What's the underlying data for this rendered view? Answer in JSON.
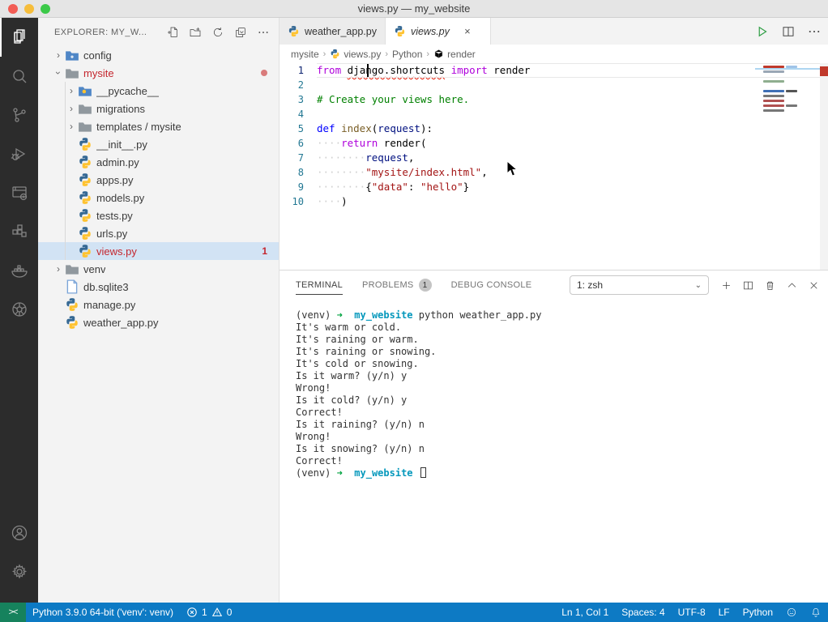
{
  "window": {
    "title": "views.py — my_website"
  },
  "colors": {
    "status_bar": "#0d7ac4",
    "remote_indicator": "#16825d",
    "activity_bar": "#2c2c2c",
    "sidebar": "#f3f3f3",
    "selection_row": "#d2e3f4",
    "error_red": "#c4262e",
    "traffic_red": "#f25c54",
    "traffic_yellow": "#f6bd3b",
    "traffic_green": "#3bc948",
    "run_green": "#2e9e44"
  },
  "activity_bar": {
    "items": [
      {
        "name": "explorer",
        "active": true
      },
      {
        "name": "search",
        "active": false
      },
      {
        "name": "source-control",
        "active": false
      },
      {
        "name": "run-debug",
        "active": false
      },
      {
        "name": "remote-explorer",
        "active": false
      },
      {
        "name": "extensions",
        "active": false
      },
      {
        "name": "docker",
        "active": false
      },
      {
        "name": "kubernetes",
        "active": false
      }
    ],
    "bottom_items": [
      {
        "name": "account",
        "active": false
      },
      {
        "name": "settings",
        "active": false
      }
    ]
  },
  "explorer": {
    "header": "EXPLORER: MY_W...",
    "actions": [
      "new-file",
      "new-folder",
      "refresh",
      "collapse-all",
      "more"
    ],
    "tree": [
      {
        "label": "config",
        "type": "folder",
        "depth": 0,
        "expanded": false,
        "icon": "folder-config"
      },
      {
        "label": "mysite",
        "type": "folder",
        "depth": 0,
        "expanded": true,
        "icon": "folder-gray",
        "red": true,
        "dot": true
      },
      {
        "label": "__pycache__",
        "type": "folder",
        "depth": 1,
        "expanded": false,
        "icon": "folder-python"
      },
      {
        "label": "migrations",
        "type": "folder",
        "depth": 1,
        "expanded": false,
        "icon": "folder-gray"
      },
      {
        "label": "templates / mysite",
        "type": "folder",
        "depth": 1,
        "expanded": false,
        "icon": "folder-gray"
      },
      {
        "label": "__init__.py",
        "type": "file",
        "depth": 1,
        "icon": "python"
      },
      {
        "label": "admin.py",
        "type": "file",
        "depth": 1,
        "icon": "python"
      },
      {
        "label": "apps.py",
        "type": "file",
        "depth": 1,
        "icon": "python"
      },
      {
        "label": "models.py",
        "type": "file",
        "depth": 1,
        "icon": "python"
      },
      {
        "label": "tests.py",
        "type": "file",
        "depth": 1,
        "icon": "python"
      },
      {
        "label": "urls.py",
        "type": "file",
        "depth": 1,
        "icon": "python"
      },
      {
        "label": "views.py",
        "type": "file",
        "depth": 1,
        "icon": "python",
        "red": true,
        "badge": "1",
        "selected": true
      },
      {
        "label": "venv",
        "type": "folder",
        "depth": 0,
        "expanded": false,
        "icon": "folder-gray"
      },
      {
        "label": "db.sqlite3",
        "type": "file",
        "depth": 0,
        "icon": "file"
      },
      {
        "label": "manage.py",
        "type": "file",
        "depth": 0,
        "icon": "python"
      },
      {
        "label": "weather_app.py",
        "type": "file",
        "depth": 0,
        "icon": "python"
      }
    ]
  },
  "tabs": [
    {
      "label": "weather_app.py",
      "active": false,
      "italic": false,
      "icon": "python"
    },
    {
      "label": "views.py",
      "active": true,
      "italic": true,
      "icon": "python",
      "close": "×"
    }
  ],
  "editor_actions": [
    {
      "name": "run-python-file"
    },
    {
      "name": "split-editor"
    },
    {
      "name": "more-actions"
    }
  ],
  "breadcrumb": [
    {
      "label": "mysite",
      "icon": null
    },
    {
      "label": "views.py",
      "icon": "python"
    },
    {
      "label": "Python",
      "icon": null
    },
    {
      "label": "render",
      "icon": "symbol-cube"
    }
  ],
  "code": {
    "lines": [
      {
        "n": 1,
        "current": true,
        "segments": [
          {
            "t": "from",
            "c": "kw"
          },
          {
            "t": " ",
            "c": "pl"
          },
          {
            "t": "django.shortcuts",
            "c": "sq"
          },
          {
            "t": " ",
            "c": "pl"
          },
          {
            "t": "import",
            "c": "kw"
          },
          {
            "t": " render",
            "c": "pl"
          }
        ]
      },
      {
        "n": 2,
        "segments": []
      },
      {
        "n": 3,
        "segments": [
          {
            "t": "# Create your views here.",
            "c": "com"
          }
        ]
      },
      {
        "n": 4,
        "segments": []
      },
      {
        "n": 5,
        "segments": [
          {
            "t": "def",
            "c": "defkw"
          },
          {
            "t": " ",
            "c": "pl"
          },
          {
            "t": "index",
            "c": "fn"
          },
          {
            "t": "(",
            "c": "pl"
          },
          {
            "t": "request",
            "c": "param"
          },
          {
            "t": "):",
            "c": "pl"
          }
        ]
      },
      {
        "n": 6,
        "segments": [
          {
            "t": "····",
            "c": "ws"
          },
          {
            "t": "return",
            "c": "kw"
          },
          {
            "t": " render(",
            "c": "pl"
          }
        ]
      },
      {
        "n": 7,
        "segments": [
          {
            "t": "········",
            "c": "ws"
          },
          {
            "t": "request",
            "c": "param"
          },
          {
            "t": ",",
            "c": "pl"
          }
        ]
      },
      {
        "n": 8,
        "segments": [
          {
            "t": "········",
            "c": "ws"
          },
          {
            "t": "\"mysite/index.html\"",
            "c": "str"
          },
          {
            "t": ",",
            "c": "pl"
          }
        ]
      },
      {
        "n": 9,
        "segments": [
          {
            "t": "········",
            "c": "ws"
          },
          {
            "t": "{",
            "c": "pl"
          },
          {
            "t": "\"data\"",
            "c": "str"
          },
          {
            "t": ": ",
            "c": "pl"
          },
          {
            "t": "\"hello\"",
            "c": "str"
          },
          {
            "t": "}",
            "c": "pl"
          }
        ]
      },
      {
        "n": 10,
        "segments": [
          {
            "t": "····",
            "c": "ws"
          },
          {
            "t": ")",
            "c": "pl"
          }
        ]
      }
    ]
  },
  "minimap": {
    "lines": [
      [
        "#c0392b",
        "#a0c4e8"
      ],
      [
        "#9aa7b5"
      ],
      [],
      [
        "#8fae8f"
      ],
      [],
      [
        "#3f6fb5",
        "#555"
      ],
      [
        "#777"
      ],
      [
        "#b05050"
      ],
      [
        "#b05050",
        "#777"
      ],
      [
        "#777"
      ]
    ]
  },
  "panel": {
    "tabs": [
      {
        "label": "TERMINAL",
        "active": true
      },
      {
        "label": "PROBLEMS",
        "active": false,
        "badge": "1"
      },
      {
        "label": "DEBUG CONSOLE",
        "active": false
      }
    ],
    "shell_select": "1: zsh",
    "actions": [
      "new-terminal",
      "split-terminal",
      "kill-terminal",
      "maximize-panel",
      "close-panel"
    ]
  },
  "terminal": {
    "lines": [
      {
        "segments": [
          {
            "t": "(venv) ",
            "c": ""
          },
          {
            "t": "➜",
            "c": "t-green"
          },
          {
            "t": "  ",
            "c": ""
          },
          {
            "t": "my_website",
            "c": "t-cyan"
          },
          {
            "t": " python weather_app.py",
            "c": ""
          }
        ]
      },
      {
        "segments": [
          {
            "t": "It's warm or cold.",
            "c": ""
          }
        ]
      },
      {
        "segments": [
          {
            "t": "It's raining or warm.",
            "c": ""
          }
        ]
      },
      {
        "segments": [
          {
            "t": "It's raining or snowing.",
            "c": ""
          }
        ]
      },
      {
        "segments": [
          {
            "t": "It's cold or snowing.",
            "c": ""
          }
        ]
      },
      {
        "segments": [
          {
            "t": "Is it warm? (y/n) y",
            "c": ""
          }
        ]
      },
      {
        "segments": [
          {
            "t": "Wrong!",
            "c": ""
          }
        ]
      },
      {
        "segments": [
          {
            "t": "Is it cold? (y/n) y",
            "c": ""
          }
        ]
      },
      {
        "segments": [
          {
            "t": "Correct!",
            "c": ""
          }
        ]
      },
      {
        "segments": [
          {
            "t": "Is it raining? (y/n) n",
            "c": ""
          }
        ]
      },
      {
        "segments": [
          {
            "t": "Wrong!",
            "c": ""
          }
        ]
      },
      {
        "segments": [
          {
            "t": "Is it snowing? (y/n) n",
            "c": ""
          }
        ]
      },
      {
        "segments": [
          {
            "t": "Correct!",
            "c": ""
          }
        ]
      },
      {
        "segments": [
          {
            "t": "(venv) ",
            "c": ""
          },
          {
            "t": "➜",
            "c": "t-green"
          },
          {
            "t": "  ",
            "c": ""
          },
          {
            "t": "my_website",
            "c": "t-cyan"
          },
          {
            "t": " ",
            "c": ""
          }
        ],
        "cursor": true
      }
    ]
  },
  "status_bar": {
    "left": [
      {
        "name": "python-interpreter",
        "text": "Python 3.9.0 64-bit ('venv': venv)"
      },
      {
        "name": "problems",
        "error_count": "1",
        "warning_count": "0"
      }
    ],
    "right": [
      {
        "name": "cursor-position",
        "text": "Ln 1, Col 1"
      },
      {
        "name": "indentation",
        "text": "Spaces: 4"
      },
      {
        "name": "encoding",
        "text": "UTF-8"
      },
      {
        "name": "eol",
        "text": "LF"
      },
      {
        "name": "language-mode",
        "text": "Python"
      }
    ]
  }
}
